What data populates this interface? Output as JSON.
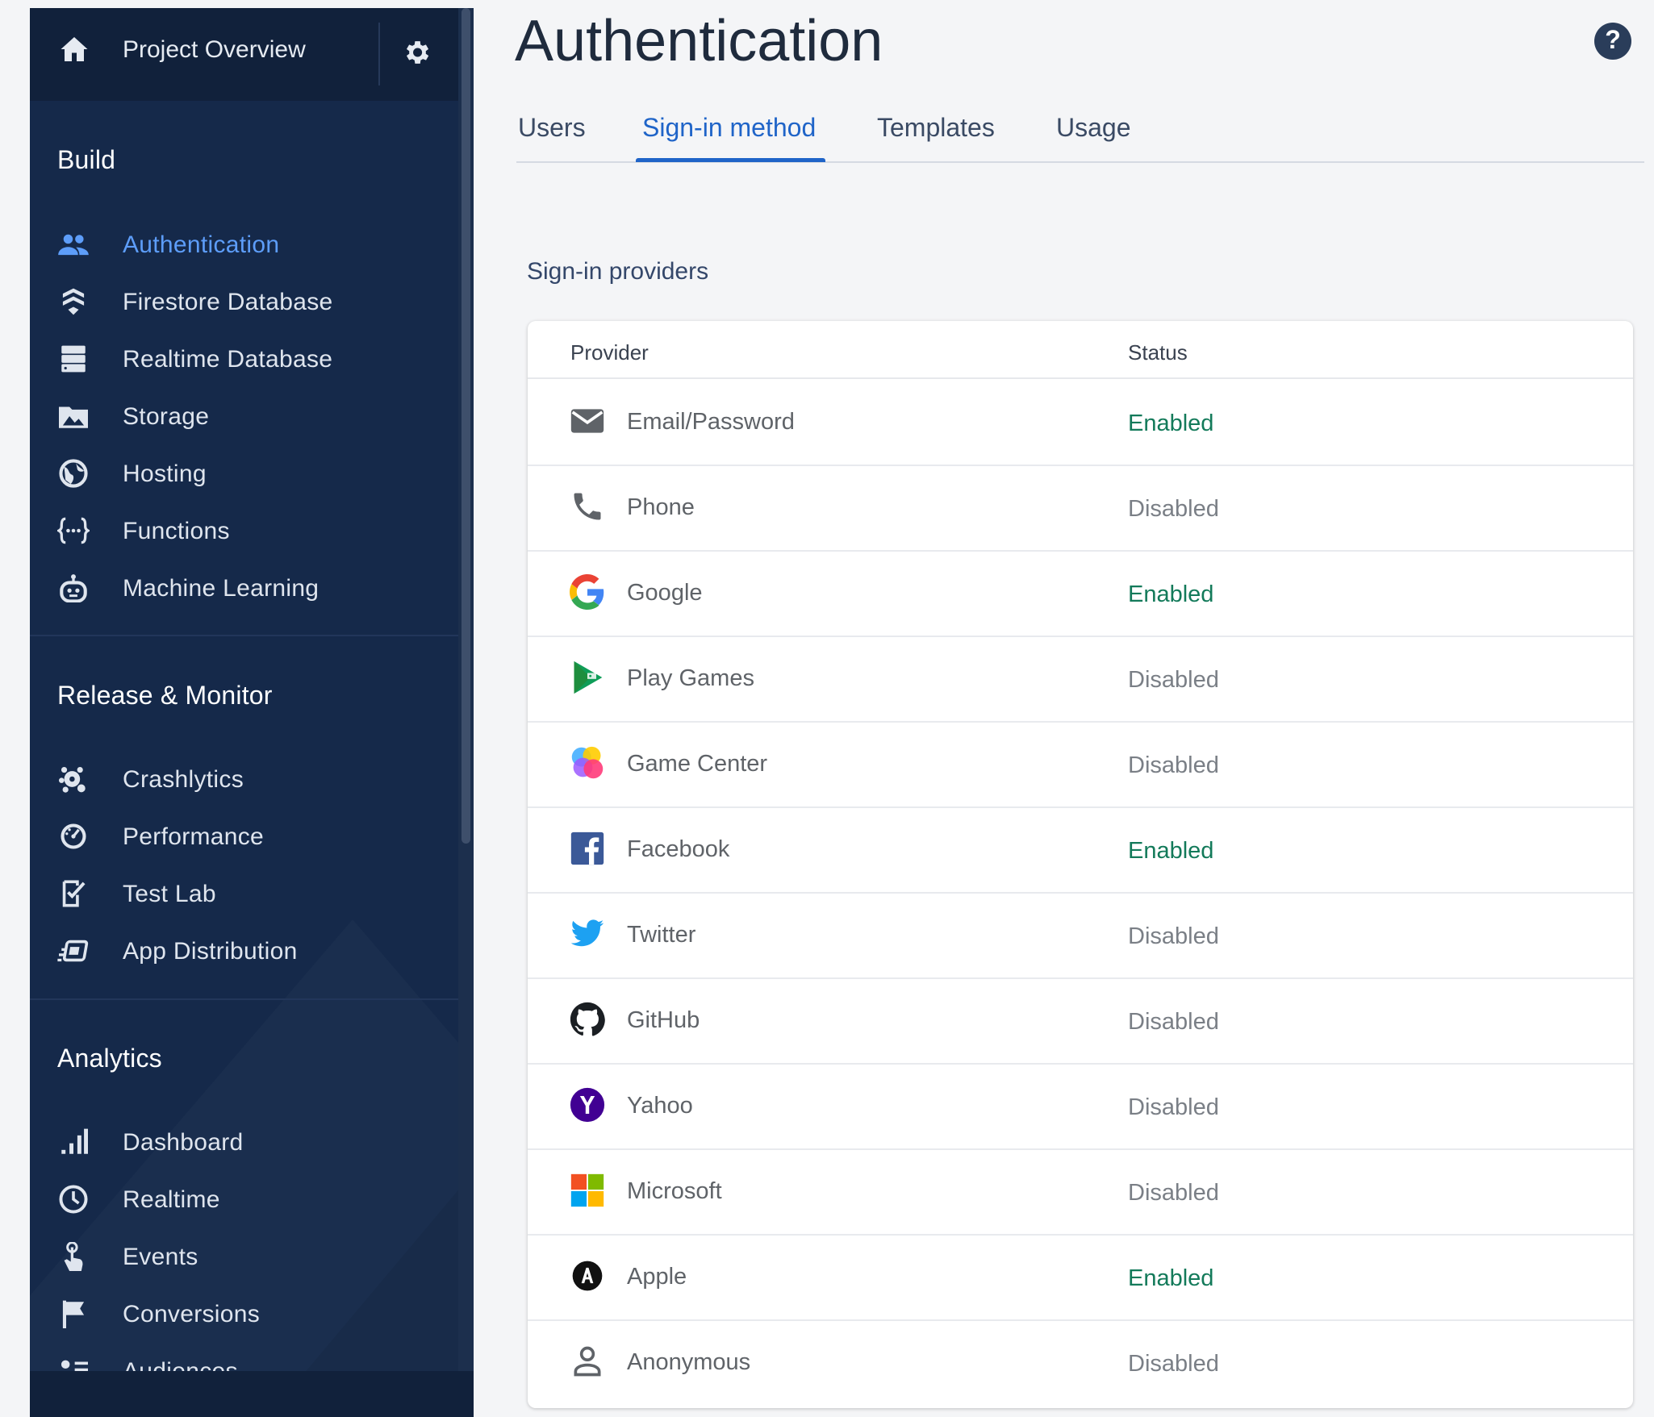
{
  "sidebar": {
    "overview_label": "Project Overview",
    "sections": [
      {
        "title": "Build",
        "items": [
          {
            "label": "Authentication",
            "icon": "people-icon",
            "active": true
          },
          {
            "label": "Firestore Database",
            "icon": "firestore-icon"
          },
          {
            "label": "Realtime Database",
            "icon": "database-icon"
          },
          {
            "label": "Storage",
            "icon": "image-icon"
          },
          {
            "label": "Hosting",
            "icon": "globe-icon"
          },
          {
            "label": "Functions",
            "icon": "functions-icon"
          },
          {
            "label": "Machine Learning",
            "icon": "robot-icon"
          }
        ]
      },
      {
        "title": "Release & Monitor",
        "items": [
          {
            "label": "Crashlytics",
            "icon": "crashlytics-icon"
          },
          {
            "label": "Performance",
            "icon": "speedometer-icon"
          },
          {
            "label": "Test Lab",
            "icon": "checklist-icon"
          },
          {
            "label": "App Distribution",
            "icon": "distribution-icon"
          }
        ]
      },
      {
        "title": "Analytics",
        "items": [
          {
            "label": "Dashboard",
            "icon": "bar-chart-icon"
          },
          {
            "label": "Realtime",
            "icon": "clock-icon"
          },
          {
            "label": "Events",
            "icon": "touch-icon"
          },
          {
            "label": "Conversions",
            "icon": "flag-icon"
          },
          {
            "label": "Audiences",
            "icon": "audience-icon"
          }
        ]
      }
    ]
  },
  "header": {
    "title": "Authentication",
    "help_icon": "help-icon",
    "help_glyph": "?"
  },
  "tabs": [
    {
      "label": "Users"
    },
    {
      "label": "Sign-in method",
      "active": true
    },
    {
      "label": "Templates"
    },
    {
      "label": "Usage"
    }
  ],
  "providers": {
    "heading": "Sign-in providers",
    "columns": {
      "provider": "Provider",
      "status": "Status"
    },
    "rows": [
      {
        "name": "Email/Password",
        "status": "Enabled",
        "icon": "email-icon"
      },
      {
        "name": "Phone",
        "status": "Disabled",
        "icon": "phone-icon"
      },
      {
        "name": "Google",
        "status": "Enabled",
        "icon": "google-icon"
      },
      {
        "name": "Play Games",
        "status": "Disabled",
        "icon": "play-games-icon"
      },
      {
        "name": "Game Center",
        "status": "Disabled",
        "icon": "game-center-icon"
      },
      {
        "name": "Facebook",
        "status": "Enabled",
        "icon": "facebook-icon"
      },
      {
        "name": "Twitter",
        "status": "Disabled",
        "icon": "twitter-icon"
      },
      {
        "name": "GitHub",
        "status": "Disabled",
        "icon": "github-icon"
      },
      {
        "name": "Yahoo",
        "status": "Disabled",
        "icon": "yahoo-icon"
      },
      {
        "name": "Microsoft",
        "status": "Disabled",
        "icon": "microsoft-icon"
      },
      {
        "name": "Apple",
        "status": "Enabled",
        "icon": "apple-icon"
      },
      {
        "name": "Anonymous",
        "status": "Disabled",
        "icon": "anonymous-icon"
      }
    ]
  },
  "colors": {
    "sidebar_bg": "#15294a",
    "active_nav": "#5d9df9",
    "tab_active": "#1f64c8",
    "status_enabled": "#137a5a",
    "status_disabled": "#7a7f86"
  }
}
